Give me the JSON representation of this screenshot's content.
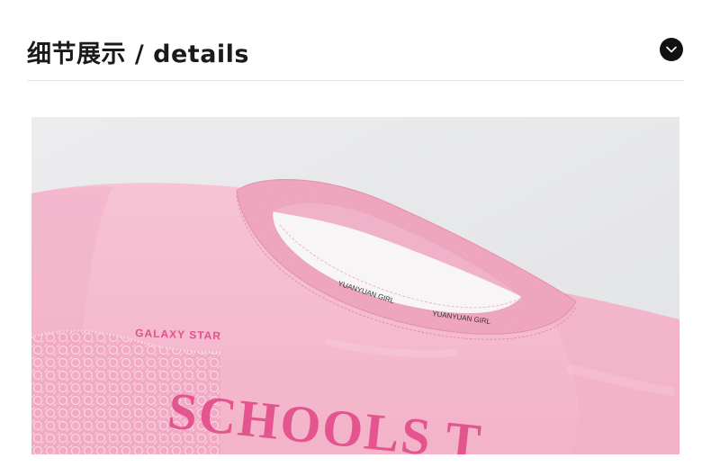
{
  "header": {
    "title": "细节展示 / details",
    "toggle_icon": "chevron-down-icon"
  },
  "photo": {
    "subject": "pink sweatshirt collar detail",
    "neck_label_text": "YUANYUAN GIRL",
    "print_small": "GALAXY STAR",
    "print_large": "SCHOOLS T",
    "colors": {
      "backdrop": "#e7e8ea",
      "fabric": "#f5bcd0",
      "rib_collar": "#f0a9c2",
      "print": "#e4558f"
    }
  }
}
